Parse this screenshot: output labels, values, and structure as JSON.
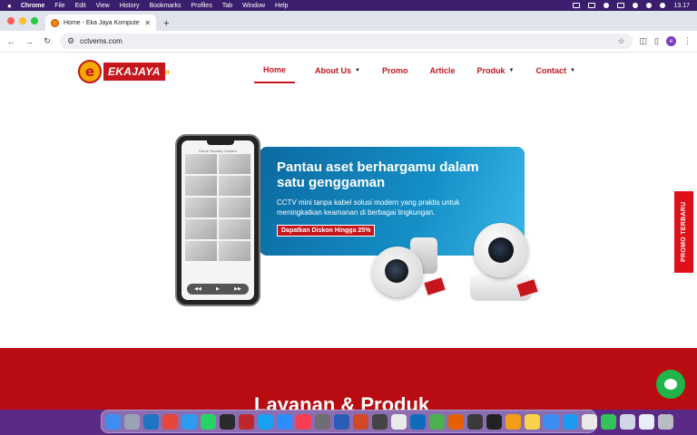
{
  "menubar": {
    "app": "Chrome",
    "items": [
      "File",
      "Edit",
      "View",
      "History",
      "Bookmarks",
      "Profiles",
      "Tab",
      "Window",
      "Help"
    ],
    "clock": "13.17"
  },
  "browser": {
    "tab_title": "Home - Eka Jaya Komputer",
    "url": "cctvems.com",
    "profile_initial": "e"
  },
  "site": {
    "logo_text": "EKAJAYA",
    "nav": [
      {
        "label": "Home",
        "active": true
      },
      {
        "label": "About Us",
        "dropdown": true
      },
      {
        "label": "Promo"
      },
      {
        "label": "Article"
      },
      {
        "label": "Produk",
        "dropdown": true
      },
      {
        "label": "Contact",
        "dropdown": true
      }
    ]
  },
  "hero": {
    "title": "Pantau aset berhargamu dalam satu genggaman",
    "description": "CCTV mini tanpa kabel solusi modern yang praktis untuk meningkatkan keamanan di berbagai lingkungan.",
    "badge": "Dapatkan Diskon Hingga 25%",
    "phone_header": "Home Security Camera"
  },
  "section": {
    "title": "Layanan & Produk"
  },
  "promo_tab": "PROMO TERBARU",
  "colors": {
    "brand_red": "#c4161c",
    "brand_yellow": "#f2a900",
    "banner_blue": "#158ec6",
    "whatsapp_green": "#20b44a"
  },
  "dock": {
    "apps": [
      {
        "name": "finder",
        "color": "#3d8ef0"
      },
      {
        "name": "launchpad",
        "color": "#9aa3b5"
      },
      {
        "name": "vscode",
        "color": "#1f74c4"
      },
      {
        "name": "chrome",
        "color": "#e8453c"
      },
      {
        "name": "safari",
        "color": "#2d9cf0"
      },
      {
        "name": "whatsapp",
        "color": "#25d366"
      },
      {
        "name": "terminal",
        "color": "#2b2b2b"
      },
      {
        "name": "filezilla",
        "color": "#c0272d"
      },
      {
        "name": "testflight",
        "color": "#1aa0f0"
      },
      {
        "name": "zoom",
        "color": "#2d8cff"
      },
      {
        "name": "music",
        "color": "#fa3c55"
      },
      {
        "name": "settings",
        "color": "#6e6e73"
      },
      {
        "name": "word",
        "color": "#2b5cb8"
      },
      {
        "name": "powerpoint",
        "color": "#d24726"
      },
      {
        "name": "calculator",
        "color": "#444"
      },
      {
        "name": "preview",
        "color": "#eaeaea"
      },
      {
        "name": "outlook",
        "color": "#0f6cbd"
      },
      {
        "name": "maps",
        "color": "#4caf50"
      },
      {
        "name": "firefox",
        "color": "#e66000"
      },
      {
        "name": "activity",
        "color": "#3a3a3a"
      },
      {
        "name": "piano",
        "color": "#222"
      },
      {
        "name": "garageband",
        "color": "#f29d1a"
      },
      {
        "name": "notes",
        "color": "#f7d24a"
      },
      {
        "name": "mail",
        "color": "#3a8ff0"
      },
      {
        "name": "appstore",
        "color": "#1e9bf0"
      },
      {
        "name": "photos",
        "color": "#e9e9e9"
      },
      {
        "name": "facetime",
        "color": "#32c45a"
      },
      {
        "name": "folder",
        "color": "#d0d6e8"
      },
      {
        "name": "documents",
        "color": "#e8edf7"
      },
      {
        "name": "trash",
        "color": "#b9bcc4"
      }
    ]
  }
}
